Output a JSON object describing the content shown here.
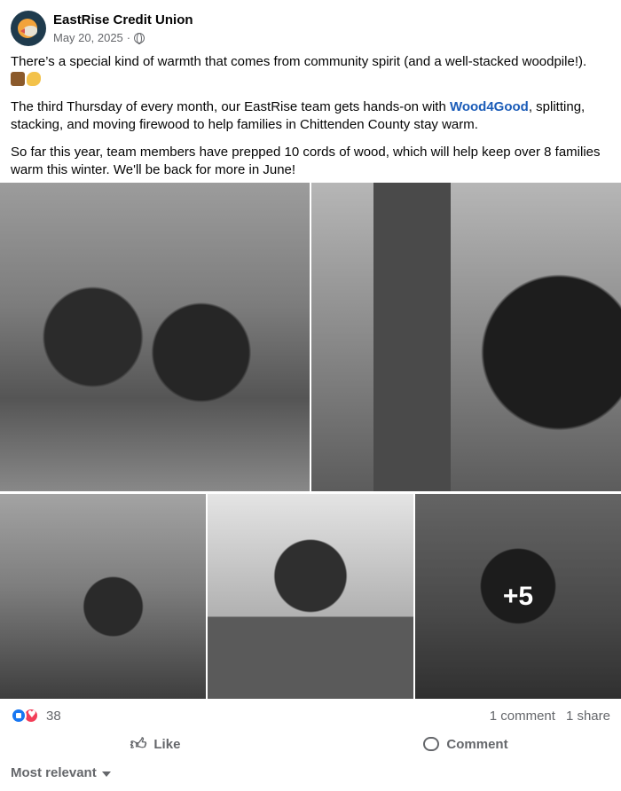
{
  "post": {
    "page_name": "EastRise Credit Union",
    "date": "May 20, 2025",
    "separator": "·",
    "privacy_icon": "globe-icon",
    "paragraph1": "There’s a special kind of warmth that comes from community spirit (and a well-stacked woodpile!).",
    "emojis": [
      "wood-icon",
      "flexed-biceps-icon"
    ],
    "paragraph2_before": "The third Thursday of every month, our EastRise team gets hands-on with ",
    "paragraph2_link": "Wood4Good",
    "paragraph2_after": ", splitting, stacking, and moving firewood to help families in Chittenden County stay warm.",
    "paragraph3": "So far this year, team members have prepped 10 cords of wood, which will help keep over 8 families warm this winter. We'll be back for more in June!"
  },
  "photos": {
    "more_count": "+5"
  },
  "engagement": {
    "reaction_count": "38",
    "comments": "1 comment",
    "shares": "1 share"
  },
  "actions": {
    "like_label": "Like",
    "comment_label": "Comment"
  },
  "comments_sort": {
    "label": "Most relevant"
  },
  "colors": {
    "link": "#1b5cb8",
    "like_reaction": "#1877f2",
    "love_reaction": "#f33e58",
    "secondary_text": "#65676b"
  }
}
